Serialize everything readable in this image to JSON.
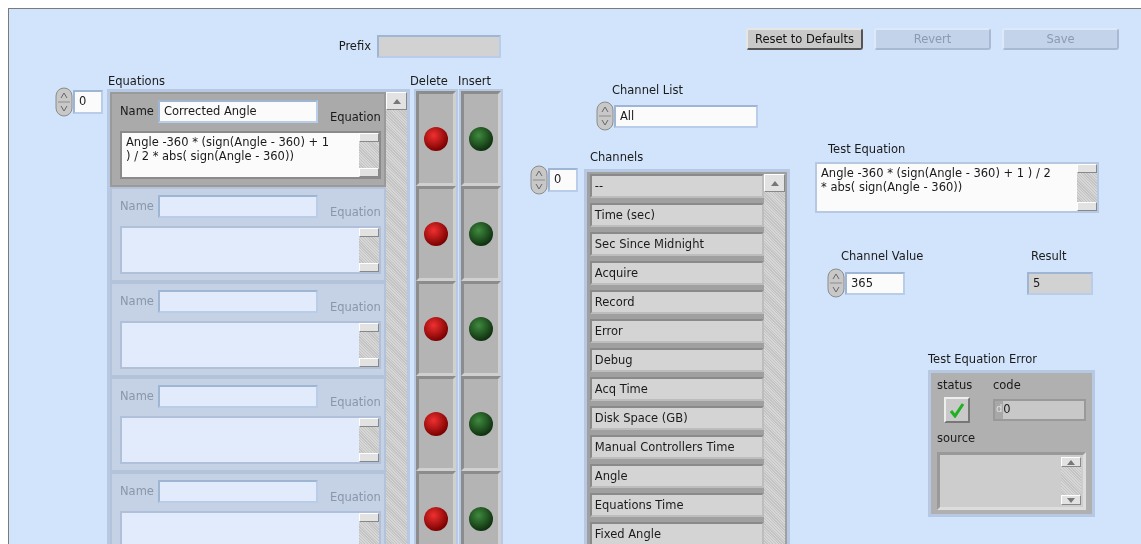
{
  "prefix": {
    "label": "Prefix"
  },
  "equations": {
    "label": "Equations",
    "index": "0",
    "delete_label": "Delete",
    "insert_label": "Insert",
    "rows": [
      {
        "name_label": "Name",
        "equation_label": "Equation",
        "name": "Corrected Angle",
        "equation": "Angle -360 * (sign(Angle - 360) + 1 ) / 2 * abs( sign(Angle - 360))",
        "disabled": false
      },
      {
        "name_label": "Name",
        "equation_label": "Equation",
        "disabled": true
      },
      {
        "name_label": "Name",
        "equation_label": "Equation",
        "disabled": true
      },
      {
        "name_label": "Name",
        "equation_label": "Equation",
        "disabled": true
      },
      {
        "name_label": "Name",
        "equation_label": "Equation",
        "disabled": true
      }
    ]
  },
  "buttons": [
    {
      "label": "Reset to Defaults",
      "disabled": false
    },
    {
      "label": "Revert",
      "disabled": true
    },
    {
      "label": "Save",
      "disabled": true
    }
  ],
  "channel_list": {
    "label": "Channel List",
    "value": "All"
  },
  "channels": {
    "label": "Channels",
    "index": "0",
    "items": [
      "--",
      "Time (sec)",
      "Sec Since Midnight",
      "Acquire",
      "Record",
      "Error",
      "Debug",
      "Acq Time",
      "Disk Space (GB)",
      "Manual Controllers  Time",
      "Angle",
      "Equations Time",
      "Fixed Angle"
    ]
  },
  "test_equation": {
    "label": "Test Equation",
    "value": "Angle -360 * (sign(Angle - 360) + 1 ) / 2 * abs( sign(Angle - 360))"
  },
  "channel_value": {
    "label": "Channel Value",
    "value": "365"
  },
  "result": {
    "label": "Result",
    "value": "5"
  },
  "error": {
    "label": "Test Equation Error",
    "status_label": "status",
    "status": true,
    "code_label": "code",
    "code_prefix": "d",
    "code": "0",
    "source_label": "source"
  }
}
